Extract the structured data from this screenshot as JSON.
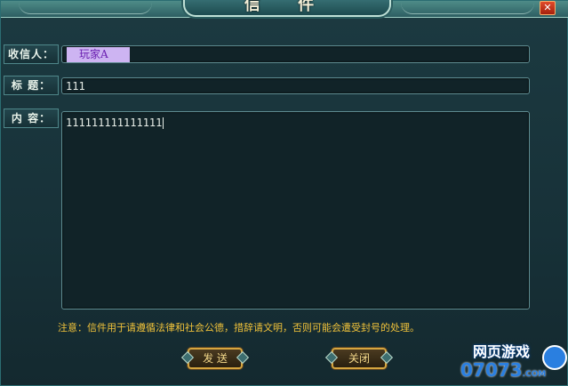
{
  "window": {
    "title": "信 件",
    "close_glyph": "✕"
  },
  "form": {
    "recipient_label": "收信人：",
    "recipient_value": "玩家A",
    "subject_label": "标 题：",
    "subject_value": "111",
    "content_label": "内 容：",
    "content_value": "111111111111111"
  },
  "notice": "注意：信件用于请遵循法律和社会公德，措辞请文明，否则可能会遭受封号的处理。",
  "buttons": {
    "send": "发 送",
    "close": "关闭"
  },
  "watermark": {
    "line1": "网页游戏",
    "line2": "07073",
    "suffix": ".COM"
  },
  "colors": {
    "background": "#1f3d44",
    "notice": "#f0c23a",
    "chip": "#cdb4f2",
    "button_border": "#d6a640"
  }
}
